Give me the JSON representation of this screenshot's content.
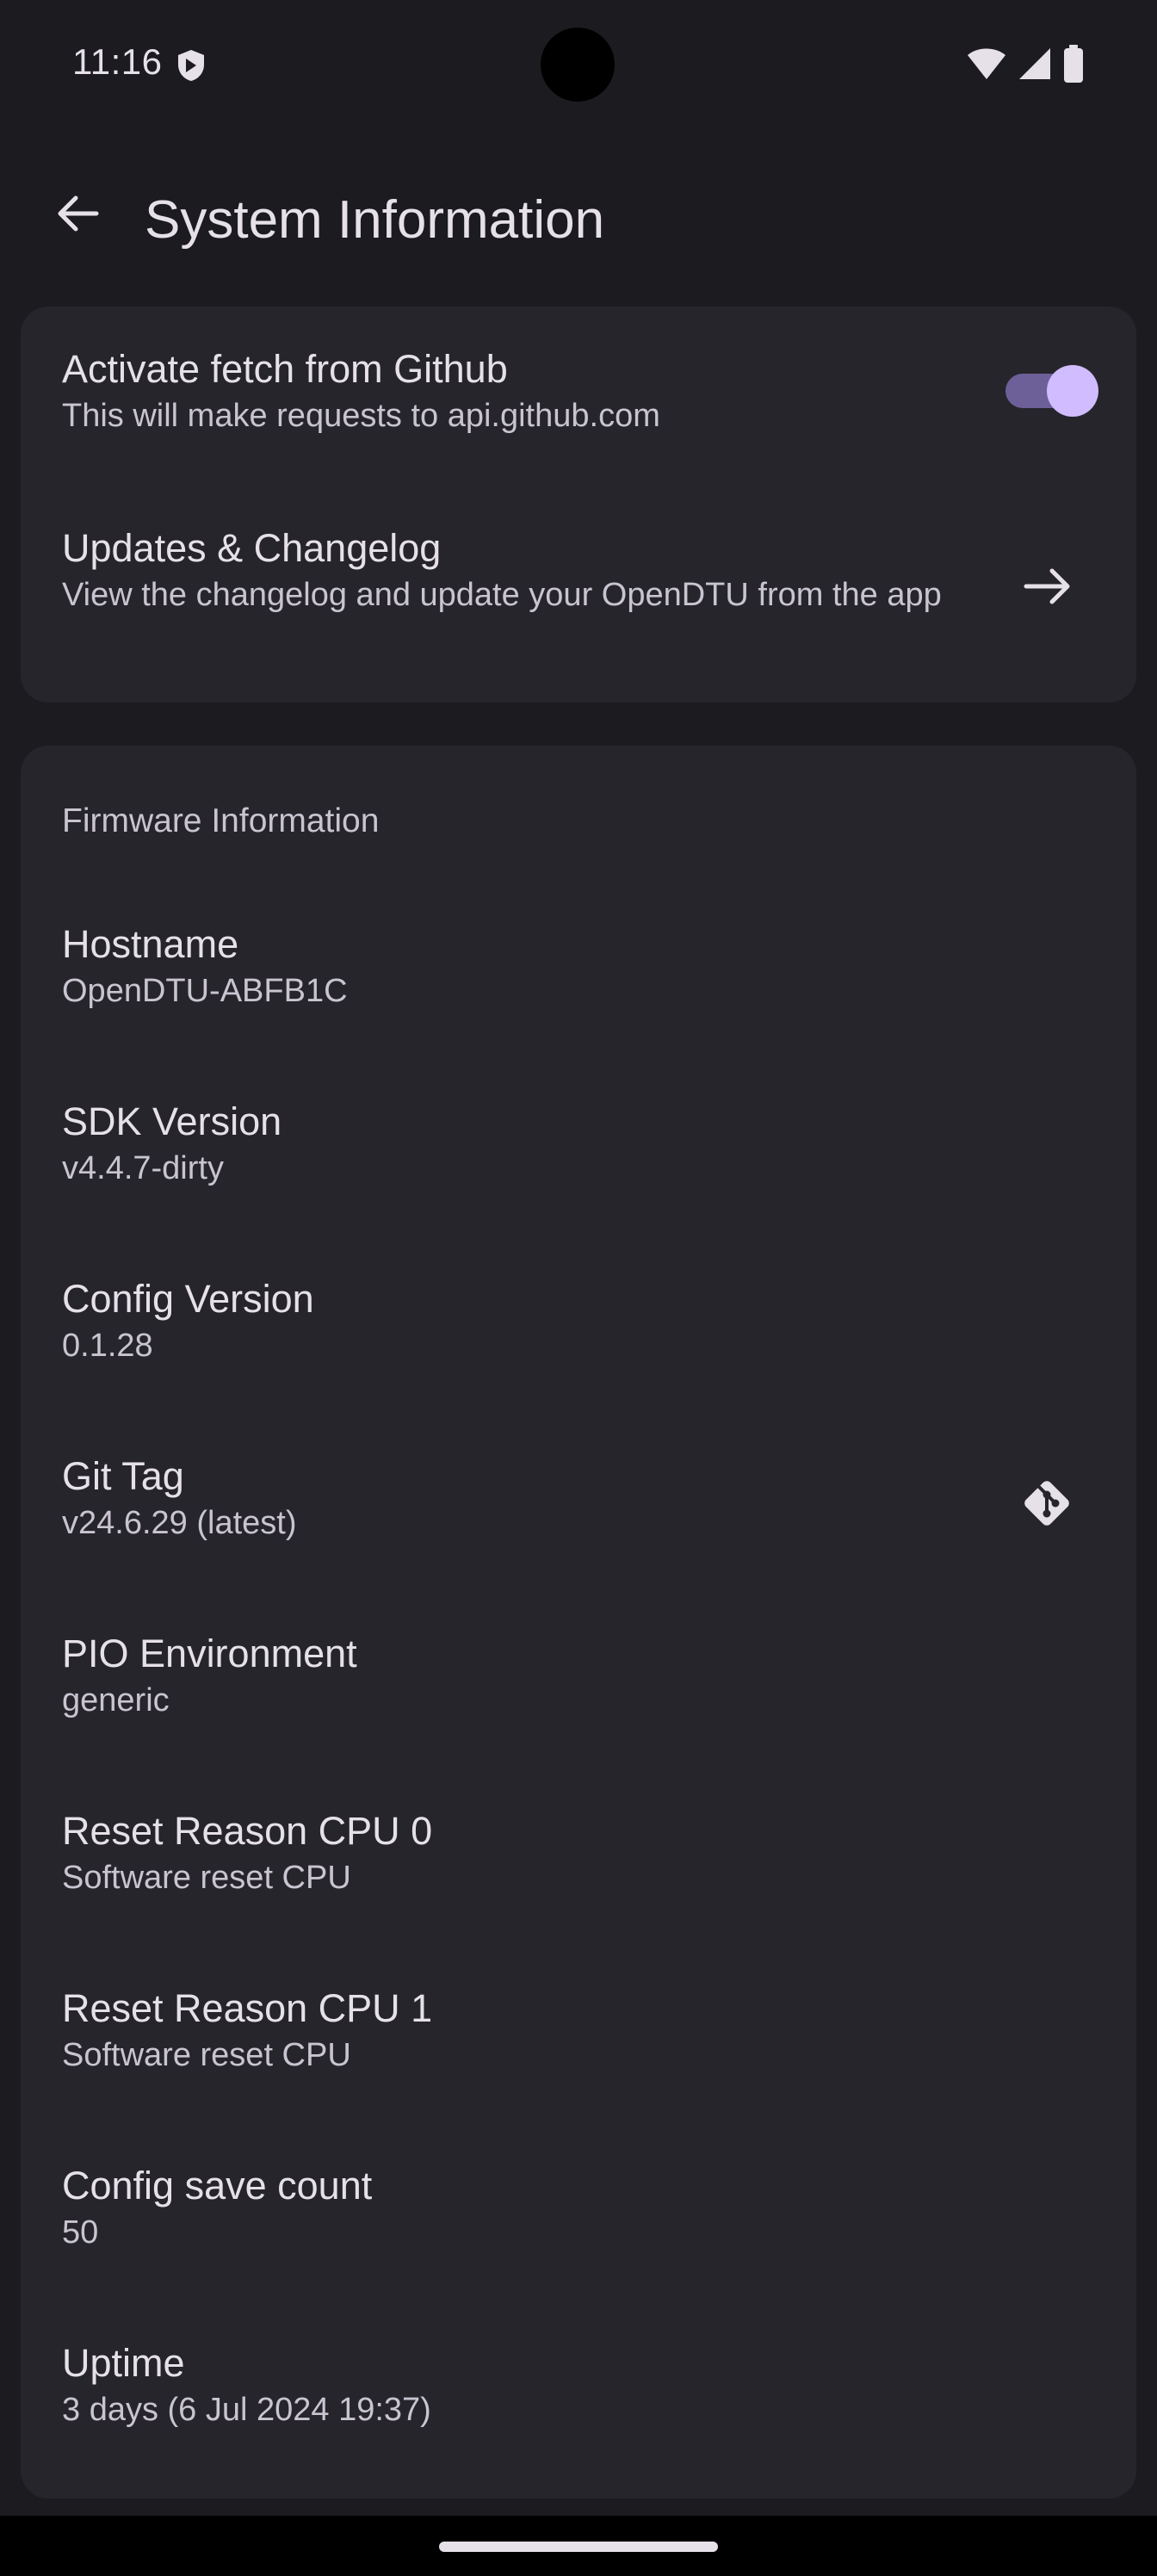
{
  "status_bar": {
    "time": "11:16",
    "icons": [
      "shield-icon",
      "wifi-icon",
      "signal-icon",
      "battery-icon"
    ]
  },
  "app_bar": {
    "title": "System Information",
    "back_icon": "arrow-left-icon"
  },
  "settings": {
    "github_fetch": {
      "title": "Activate fetch from Github",
      "subtitle": "This will make requests to api.github.com",
      "enabled": true
    },
    "updates": {
      "title": "Updates & Changelog",
      "subtitle": "View the changelog and update your OpenDTU from the app",
      "icon": "arrow-right-icon"
    }
  },
  "firmware": {
    "section_title": "Firmware Information",
    "items": [
      {
        "title": "Hostname",
        "value": "OpenDTU-ABFB1C"
      },
      {
        "title": "SDK Version",
        "value": "v4.4.7-dirty"
      },
      {
        "title": "Config Version",
        "value": "0.1.28"
      },
      {
        "title": "Git Tag",
        "value": "v24.6.29 (latest)",
        "icon": "git-icon"
      },
      {
        "title": "PIO Environment",
        "value": "generic"
      },
      {
        "title": "Reset Reason CPU 0",
        "value": "Software reset CPU"
      },
      {
        "title": "Reset Reason CPU 1",
        "value": "Software reset CPU"
      },
      {
        "title": "Config save count",
        "value": "50"
      },
      {
        "title": "Uptime",
        "value": "3 days (6 Jul 2024 19:37)"
      }
    ]
  },
  "colors": {
    "background": "#1c1b20",
    "card": "#26252b",
    "accent": "#d0bcff",
    "text_primary": "#e6e1e9",
    "text_secondary": "#c9c4d0"
  }
}
